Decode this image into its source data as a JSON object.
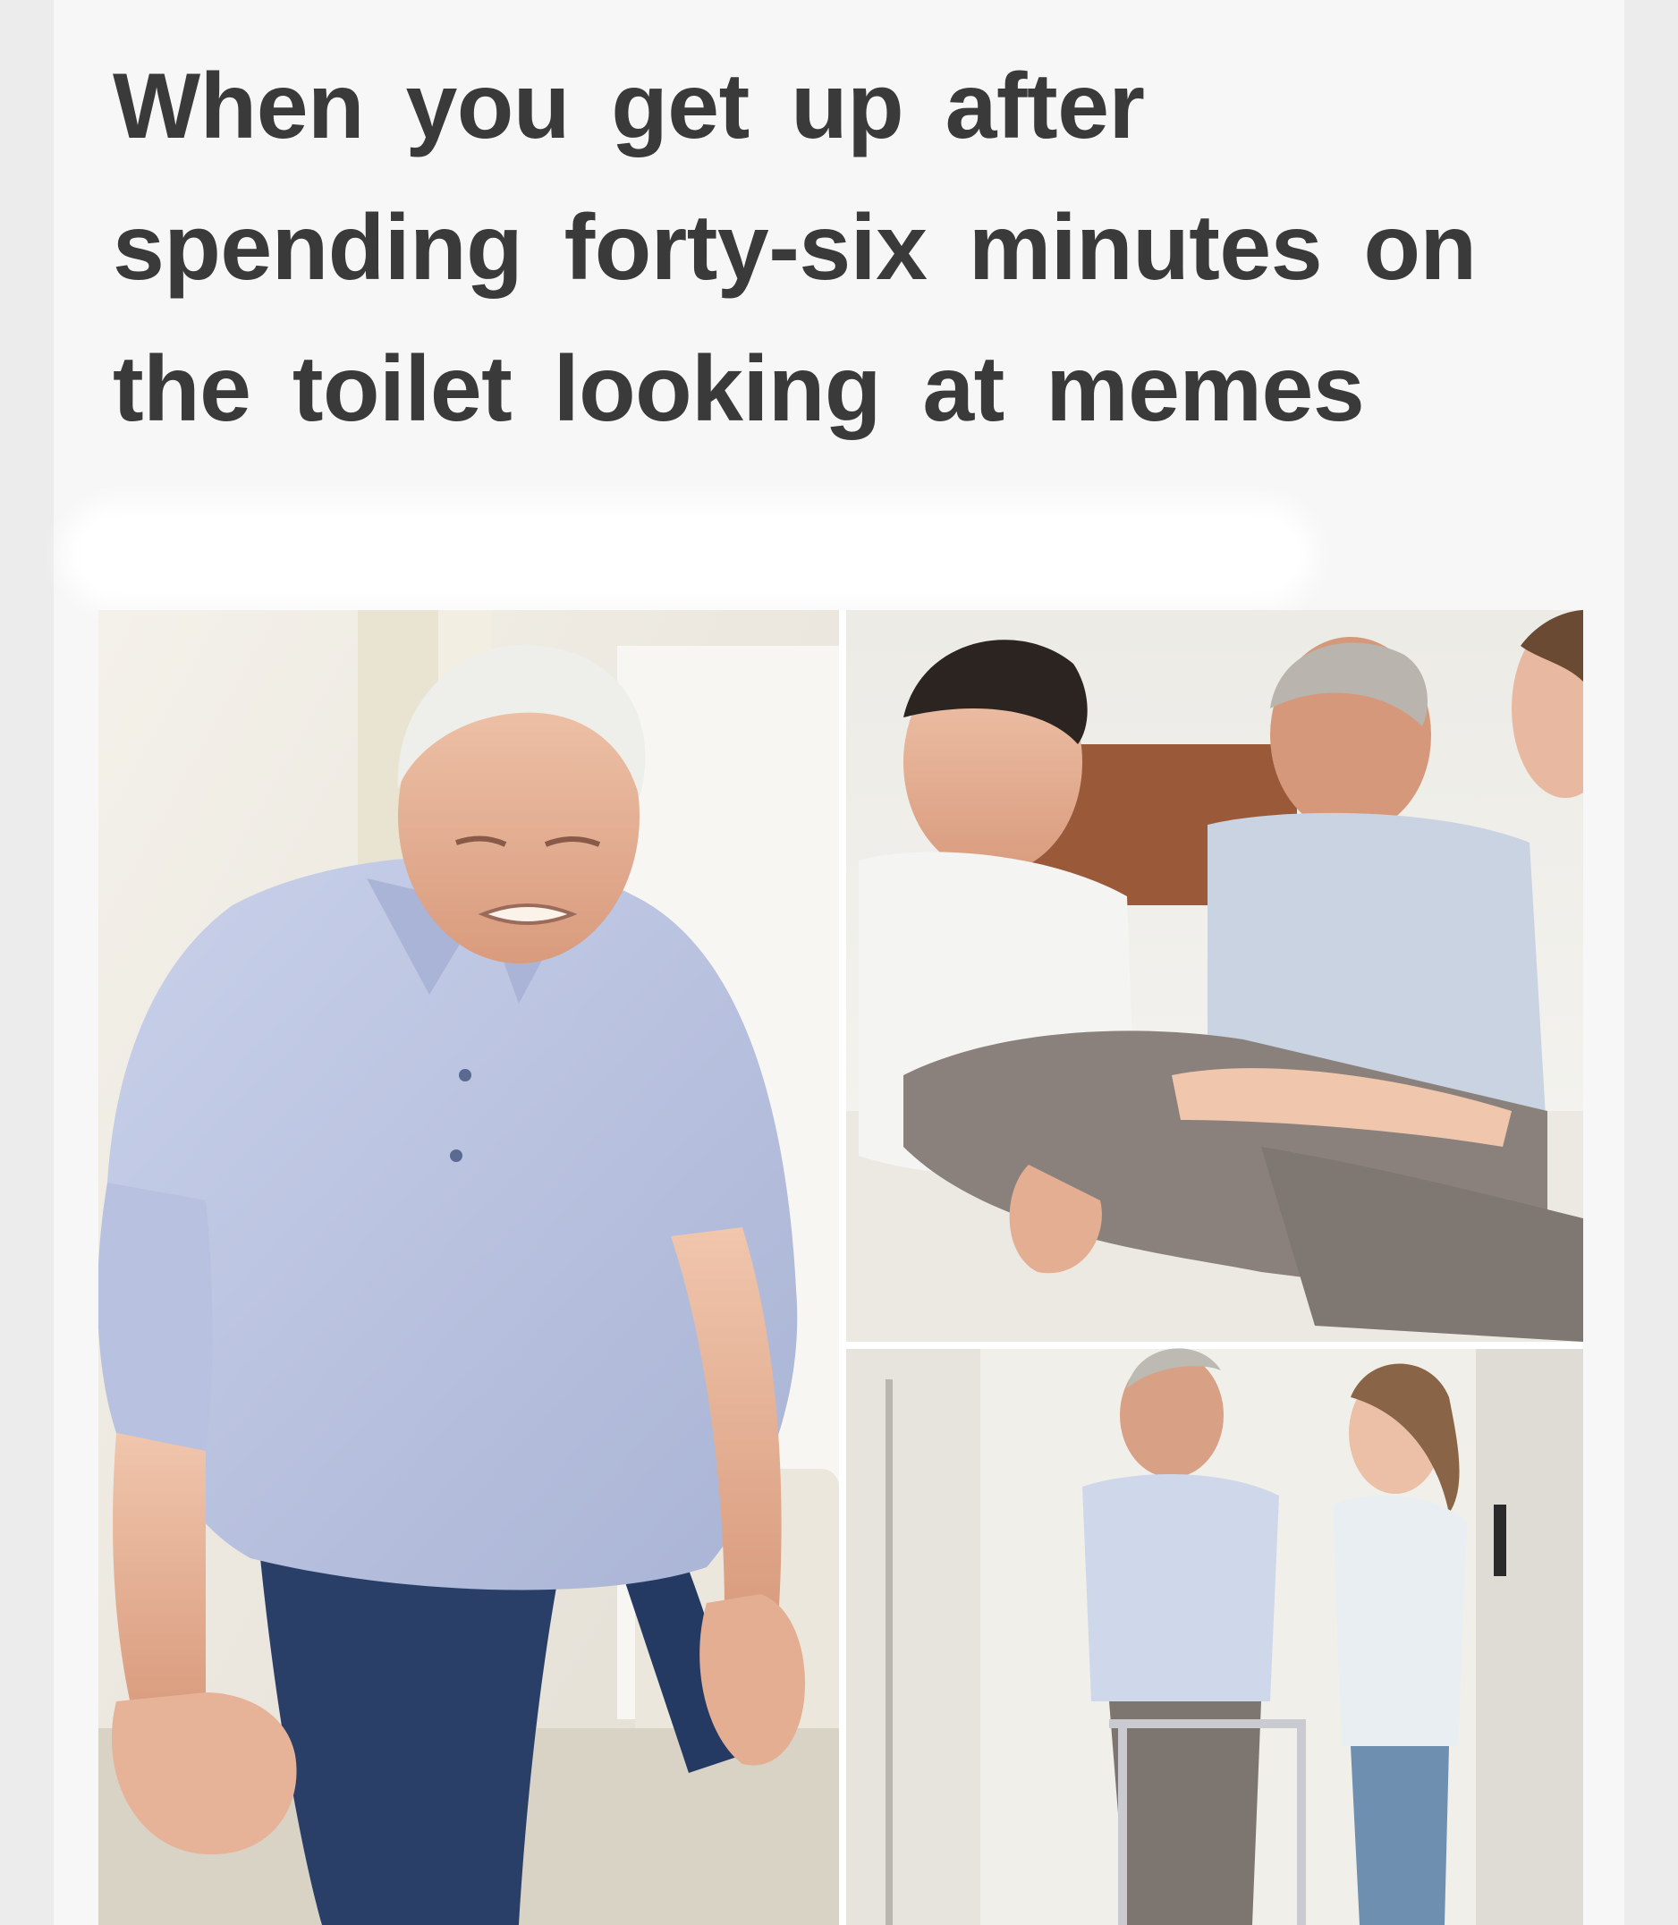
{
  "caption": {
    "line1": "When you get up after",
    "line2": "spending forty-six minutes on",
    "line3": "the toilet looking at memes"
  },
  "colors": {
    "background": "#ececec",
    "card": "#f7f7f7",
    "caption_text": "#3a3a3a",
    "shirt_blue": "#b9c3df",
    "pants_navy": "#2a3f68",
    "pants_grey": "#8a817c",
    "headboard": "#9a5a3a"
  },
  "panels": [
    {
      "id": "left",
      "depicts": "elderly man grimacing while getting up with hands on knees"
    },
    {
      "id": "top-right",
      "depicts": "two helpers holding an elderly man's leg on a bed"
    },
    {
      "id": "bottom-right",
      "depicts": "elderly man walking with a walker beside a nurse"
    }
  ]
}
